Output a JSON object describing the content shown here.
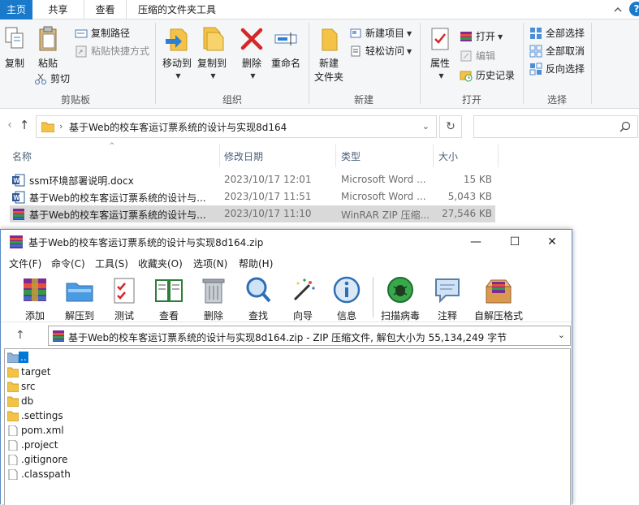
{
  "explorer": {
    "tabs": [
      "主页",
      "共享",
      "查看",
      "压缩的文件夹工具"
    ],
    "help": "?",
    "ribbon": {
      "clipboard": {
        "copy": "复制",
        "paste": "粘贴",
        "copy_path": "复制路径",
        "paste_shortcut": "粘贴快捷方式",
        "cut": "剪切",
        "group": "剪贴板"
      },
      "organize": {
        "move_to": "移动到",
        "copy_to": "复制到",
        "delete": "删除",
        "rename": "重命名",
        "group": "组织"
      },
      "new": {
        "new_folder_l1": "新建",
        "new_folder_l2": "文件夹",
        "new_item": "新建项目",
        "easy_access": "轻松访问",
        "group": "新建"
      },
      "open": {
        "properties": "属性",
        "open": "打开",
        "edit": "编辑",
        "history": "历史记录",
        "group": "打开"
      },
      "select": {
        "select_all": "全部选择",
        "select_none": "全部取消",
        "invert": "反向选择",
        "group": "选择"
      }
    },
    "address": {
      "path": "基于Web的校车客运订票系统的设计与实现8d164"
    },
    "columns": {
      "name": "名称",
      "date": "修改日期",
      "type": "类型",
      "size": "大小"
    },
    "files": [
      {
        "name": "ssm环境部署说明.docx",
        "date": "2023/10/17 12:01",
        "type": "Microsoft Word ...",
        "size": "15 KB",
        "icon": "word-icon"
      },
      {
        "name": "基于Web的校车客运订票系统的设计与...",
        "date": "2023/10/17 11:51",
        "type": "Microsoft Word ...",
        "size": "5,043 KB",
        "icon": "word-icon"
      },
      {
        "name": "基于Web的校车客运订票系统的设计与...",
        "date": "2023/10/17 11:10",
        "type": "WinRAR ZIP 压缩...",
        "size": "27,546 KB",
        "icon": "winrar-icon",
        "selected": true
      }
    ]
  },
  "winrar": {
    "title": "基于Web的校车客运订票系统的设计与实现8d164.zip",
    "menu": [
      "文件(F)",
      "命令(C)",
      "工具(S)",
      "收藏夹(O)",
      "选项(N)",
      "帮助(H)"
    ],
    "tools": [
      "添加",
      "解压到",
      "测试",
      "查看",
      "删除",
      "查找",
      "向导",
      "信息",
      "扫描病毒",
      "注释",
      "自解压格式"
    ],
    "address": "基于Web的校车客运订票系统的设计与实现8d164.zip - ZIP 压缩文件, 解包大小为 55,134,249 字节",
    "items": [
      {
        "name": "..",
        "icon": "folder-up-icon"
      },
      {
        "name": "target",
        "icon": "folder-icon"
      },
      {
        "name": "src",
        "icon": "folder-icon"
      },
      {
        "name": "db",
        "icon": "folder-icon"
      },
      {
        "name": ".settings",
        "icon": "folder-icon"
      },
      {
        "name": "pom.xml",
        "icon": "file-icon"
      },
      {
        "name": ".project",
        "icon": "file-icon"
      },
      {
        "name": ".gitignore",
        "icon": "file-icon"
      },
      {
        "name": ".classpath",
        "icon": "file-icon"
      }
    ]
  },
  "colors": {
    "accent": "#1979ca",
    "selected_row": "#d9d9d9",
    "folder": "#f4c246",
    "winrar_sel": "#0078d7"
  }
}
